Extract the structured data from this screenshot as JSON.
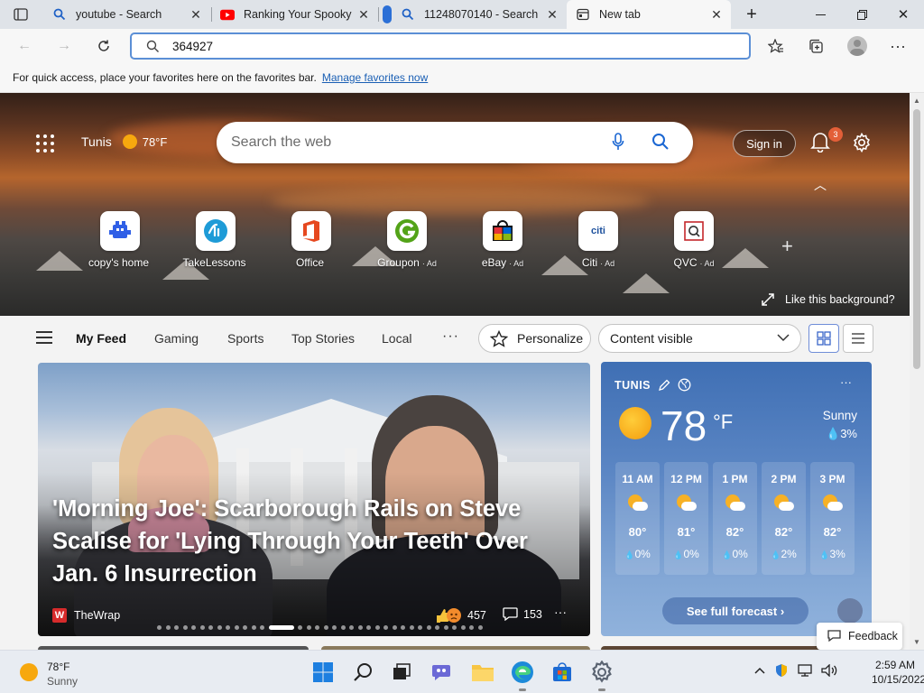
{
  "browser": {
    "tabs": [
      {
        "title": "youtube - Search",
        "icon": "search-icon"
      },
      {
        "title": "Ranking Your Spooky",
        "icon": "youtube-icon"
      },
      {
        "title": "11248070140 - Search",
        "icon": "search-icon"
      },
      {
        "title": "New tab",
        "icon": "newtab-icon",
        "active": true
      }
    ],
    "address_value": "364927",
    "favorites_bar": {
      "message": "For quick access, place your favorites here on the favorites bar.",
      "link": "Manage favorites now"
    }
  },
  "hero": {
    "location": "Tunis",
    "temp": "78°F",
    "search_placeholder": "Search the web",
    "signin": "Sign in",
    "notifications": "3",
    "quick_links": [
      {
        "label": "copy's home",
        "ad": ""
      },
      {
        "label": "TakeLessons",
        "ad": ""
      },
      {
        "label": "Office",
        "ad": ""
      },
      {
        "label": "Groupon",
        "ad": "· Ad"
      },
      {
        "label": "eBay",
        "ad": "· Ad"
      },
      {
        "label": "Citi",
        "ad": "· Ad"
      },
      {
        "label": "QVC",
        "ad": "· Ad"
      }
    ],
    "citi_logo": "citi",
    "like_background": "Like this background?"
  },
  "feed_nav": {
    "tabs": [
      "My Feed",
      "Gaming",
      "Sports",
      "Top Stories",
      "Local"
    ],
    "more": "···",
    "personalize": "Personalize",
    "content_visible": "Content visible"
  },
  "news": {
    "headline": "'Morning Joe': Scarborough Rails on Steve Scalise for 'Lying Through Your Teeth' Over Jan. 6 Insurrection",
    "source_logo": "W",
    "source": "TheWrap",
    "reactions": "457",
    "comments": "153",
    "more": "···",
    "carousel_count": 36,
    "carousel_active": 13
  },
  "weather": {
    "city": "TUNIS",
    "more": "···",
    "temp": "78",
    "unit": "°F",
    "condition": "Sunny",
    "precip": "3%",
    "hourly": [
      {
        "time": "11 AM",
        "temp": "80°",
        "precip": "0%"
      },
      {
        "time": "12 PM",
        "temp": "81°",
        "precip": "0%"
      },
      {
        "time": "1 PM",
        "temp": "82°",
        "precip": "0%"
      },
      {
        "time": "2 PM",
        "temp": "82°",
        "precip": "2%"
      },
      {
        "time": "3 PM",
        "temp": "82°",
        "precip": "3%"
      }
    ],
    "forecast_button": "See full forecast ›"
  },
  "feedback": "Feedback",
  "taskbar": {
    "weather_temp": "78°F",
    "weather_cond": "Sunny",
    "time": "2:59 AM",
    "date": "10/15/2022"
  },
  "colors": {
    "accent": "#0067c0",
    "weather_bg": "#3f6fb4",
    "badge": "#e35f38"
  }
}
